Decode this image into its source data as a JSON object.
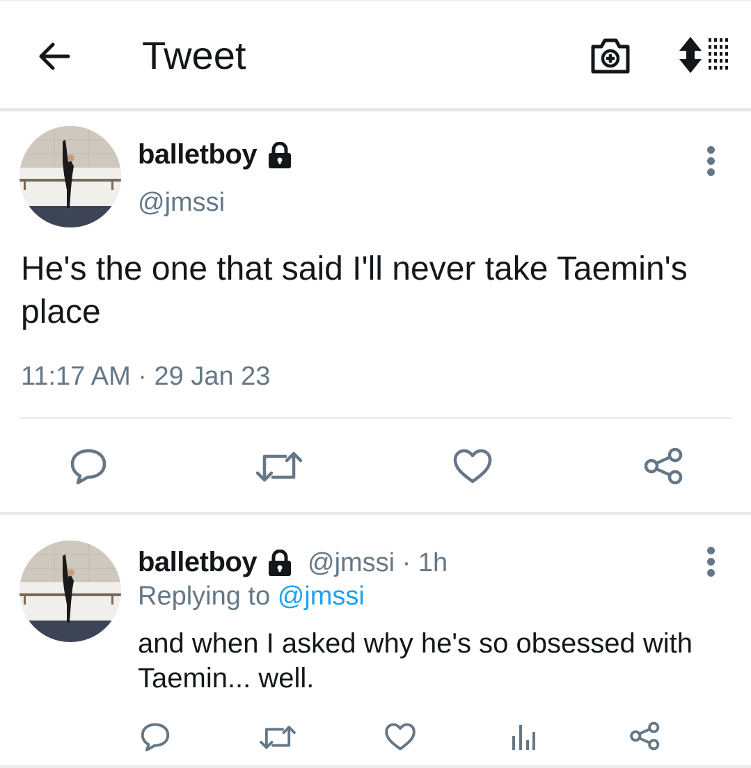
{
  "header": {
    "title": "Tweet",
    "icons": [
      "arrow-left-icon",
      "camera-plus-icon",
      "sort-icon"
    ]
  },
  "main_tweet": {
    "display_name": "balletboy",
    "handle": "@jmssi",
    "text": "He's the one that said I'll never take Taemin's place",
    "timestamp": "11:17 AM · 29 Jan 23",
    "actions": [
      "reply-icon",
      "retweet-icon",
      "like-icon",
      "share-icon"
    ]
  },
  "reply_tweet": {
    "display_name": "balletboy",
    "handle_time": "@jmssi · 1h",
    "replying_prefix": "Replying to",
    "replying_handle": "@jmssi",
    "text": "and when I asked why he's so obsessed with Taemin... well.",
    "actions": [
      "reply-icon",
      "retweet-icon",
      "like-icon",
      "analytics-icon",
      "share-icon"
    ]
  },
  "colors": {
    "text": "#14171a",
    "secondary": "#657786",
    "accent": "#1da1f2",
    "divider": "#e6ecf0"
  }
}
